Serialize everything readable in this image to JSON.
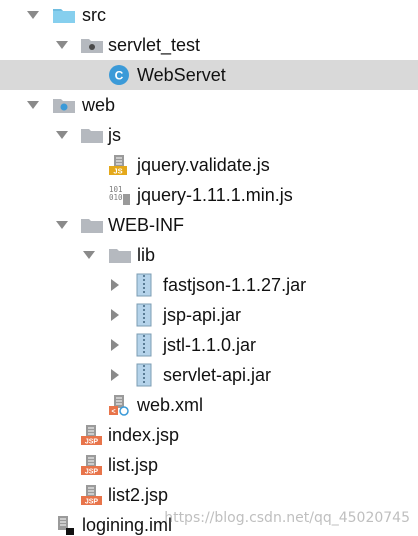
{
  "tree": {
    "items": [
      {
        "label": "src",
        "icon": "source-folder-icon",
        "arrow": "expanded"
      },
      {
        "label": "servlet_test",
        "icon": "package-folder-icon",
        "arrow": "expanded"
      },
      {
        "label": "WebServet",
        "icon": "class-icon",
        "arrow": "none",
        "selected": true
      },
      {
        "label": "web",
        "icon": "web-folder-icon",
        "arrow": "expanded"
      },
      {
        "label": "js",
        "icon": "folder-icon",
        "arrow": "expanded"
      },
      {
        "label": "jquery.validate.js",
        "icon": "js-file-icon",
        "arrow": "none"
      },
      {
        "label": "jquery-1.11.1.min.js",
        "icon": "binary-file-icon",
        "arrow": "none"
      },
      {
        "label": "WEB-INF",
        "icon": "folder-icon",
        "arrow": "expanded"
      },
      {
        "label": "lib",
        "icon": "folder-icon",
        "arrow": "expanded"
      },
      {
        "label": "fastjson-1.1.27.jar",
        "icon": "jar-archive-icon",
        "arrow": "collapsed"
      },
      {
        "label": "jsp-api.jar",
        "icon": "jar-archive-icon",
        "arrow": "collapsed"
      },
      {
        "label": "jstl-1.1.0.jar",
        "icon": "jar-archive-icon",
        "arrow": "collapsed"
      },
      {
        "label": "servlet-api.jar",
        "icon": "jar-archive-icon",
        "arrow": "collapsed"
      },
      {
        "label": "web.xml",
        "icon": "web-xml-icon",
        "arrow": "none"
      },
      {
        "label": "index.jsp",
        "icon": "jsp-file-icon",
        "arrow": "none"
      },
      {
        "label": "list.jsp",
        "icon": "jsp-file-icon",
        "arrow": "none"
      },
      {
        "label": "list2.jsp",
        "icon": "jsp-file-icon",
        "arrow": "none"
      },
      {
        "label": "logining.iml",
        "icon": "iml-module-icon",
        "arrow": "none"
      }
    ]
  },
  "watermark": "https://blog.csdn.net/qq_45020745",
  "colors": {
    "selected_row": "#d9d9d9",
    "folder_blue": "#86cfee",
    "folder_grey": "#b5b9bf",
    "class_blue": "#3b9ad8",
    "jsp_orange": "#e8744a",
    "js_yellow": "#e4a81a"
  }
}
